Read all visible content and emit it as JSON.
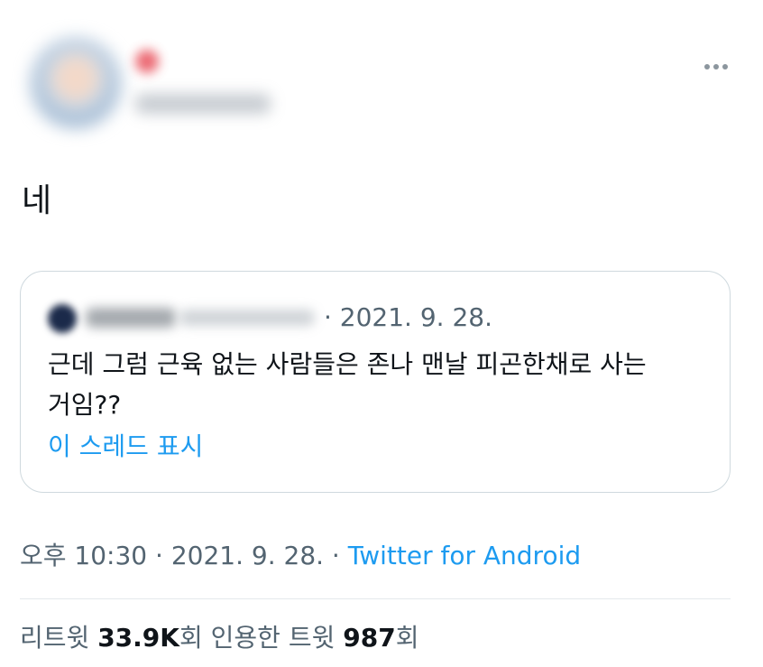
{
  "tweet": {
    "text": "네",
    "quote": {
      "date": "· 2021. 9. 28.",
      "text": "근데 그럼 근육 없는 사람들은 존나 맨날 피곤한채로 사는 거임??",
      "show_thread": "이 스레드 표시"
    },
    "meta": {
      "time": "오후 10:30",
      "sep1": " · ",
      "date": "2021. 9. 28.",
      "sep2": " · ",
      "source": "Twitter for Android"
    },
    "stats": {
      "retweets_label": "리트윗",
      "retweets_count": "33.9K",
      "retweets_unit": "회",
      "quotes_label": "인용한 트윗",
      "quotes_count": "987",
      "quotes_unit": "회"
    }
  },
  "icons": {
    "more": "more-horizontal-icon"
  }
}
